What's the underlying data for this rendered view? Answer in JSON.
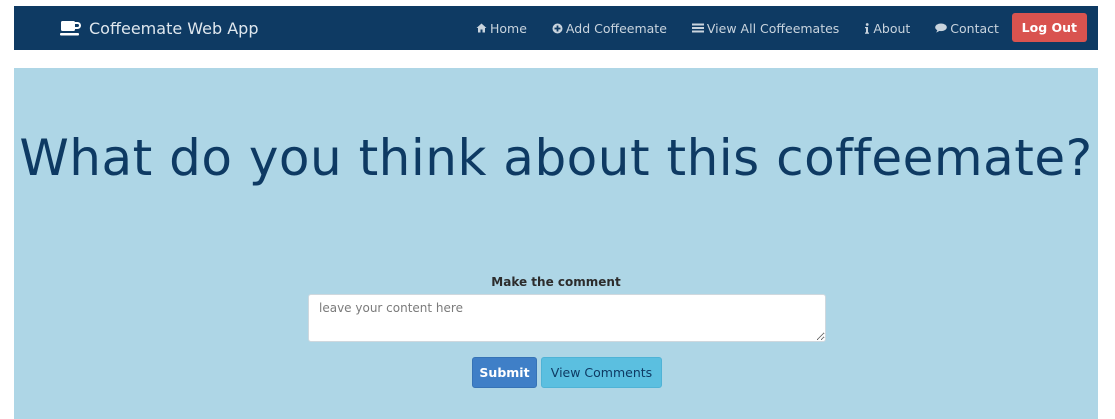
{
  "navbar": {
    "brand": {
      "icon": "coffee-cup-icon",
      "label": "Coffeemate Web App"
    },
    "links": [
      {
        "icon": "home-icon",
        "label": "Home"
      },
      {
        "icon": "plus-circle-icon",
        "label": "Add Coffeemate"
      },
      {
        "icon": "list-icon",
        "label": "View All Coffeemates"
      },
      {
        "icon": "info-icon",
        "label": "About"
      },
      {
        "icon": "comment-icon",
        "label": "Contact"
      }
    ],
    "logout_label": "Log Out"
  },
  "main": {
    "headline": "What do you think about this coffeemate?",
    "comment_label": "Make the comment",
    "comment_placeholder": "leave your content here",
    "comment_value": "",
    "submit_label": "Submit",
    "view_comments_label": "View Comments"
  },
  "colors": {
    "navbar_bg": "#0e3a63",
    "jumbotron_bg": "#aed6e6",
    "headline": "#0e3a63",
    "logout_bg": "#d9534f",
    "submit_bg": "#3f7fc7",
    "view_comments_bg": "#5bbfe0"
  }
}
